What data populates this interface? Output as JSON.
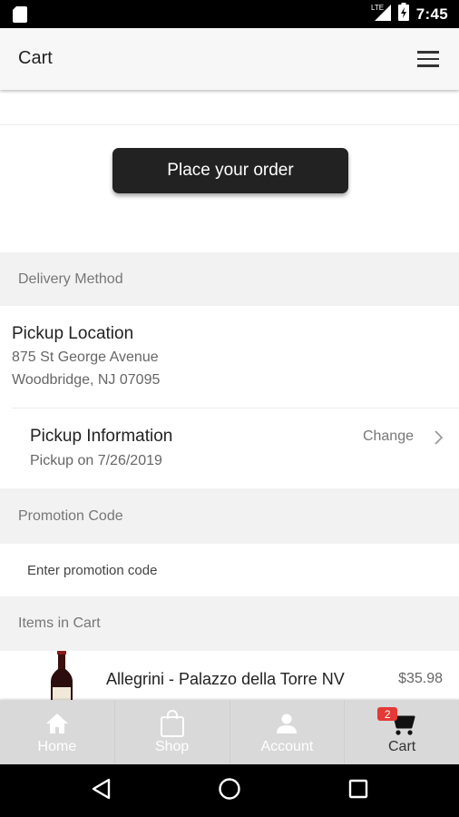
{
  "status_bar": {
    "time": "7:45",
    "network": "LTE"
  },
  "app_bar": {
    "title": "Cart"
  },
  "actions": {
    "place_order_label": "Place your order"
  },
  "sections": {
    "delivery_method": "Delivery Method",
    "promotion_code": "Promotion Code",
    "items_in_cart": "Items in Cart"
  },
  "pickup_location": {
    "label": "Pickup Location",
    "address_line1": "875 St George Avenue",
    "address_line2": "Woodbridge, NJ 07095"
  },
  "pickup_info": {
    "label": "Pickup Information",
    "date": "Pickup on 7/26/2019",
    "change_label": "Change"
  },
  "promo": {
    "placeholder": "Enter promotion code",
    "value": ""
  },
  "cart_items": [
    {
      "name": "Allegrini - Palazzo della Torre NV",
      "price": "$35.98"
    }
  ],
  "tabs": [
    {
      "label": "Home",
      "icon": "home-icon"
    },
    {
      "label": "Shop",
      "icon": "shopping-bag-icon"
    },
    {
      "label": "Account",
      "icon": "person-icon"
    },
    {
      "label": "Cart",
      "icon": "cart-icon",
      "badge": "2",
      "active": true
    }
  ],
  "colors": {
    "primary_button": "#222222",
    "badge": "#e53935",
    "section_bg": "#f2f2f2",
    "tab_bar_bg": "#d9d9d9"
  }
}
